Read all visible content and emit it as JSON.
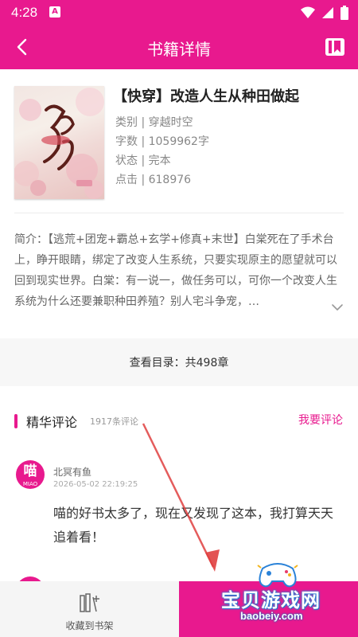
{
  "status_bar": {
    "time": "4:28",
    "app_icon_letter": "A",
    "icons": [
      "wifi-icon",
      "signal-icon",
      "battery-icon"
    ]
  },
  "header": {
    "title": "书籍详情",
    "back_icon": "chevron-left-icon",
    "action_icon": "bookshelf-icon"
  },
  "book": {
    "title": "【快穿】改造人生从种田做起",
    "category": "类别 | 穿越时空",
    "word_count": "字数 | 1059962字",
    "status": "状态 | 完本",
    "clicks": "点击 | 618976"
  },
  "synopsis": {
    "text": "简介：【逃荒+团宠+霸总+玄学+修真+末世】白棠死在了手术台上，睁开眼睛，绑定了改变人生系统，只要实现原主的愿望就可以回到现实世界。白棠：有一说一，做任务可以，可你一个改变人生系统为什么还要兼职种田养殖？别人宅斗争宠，…"
  },
  "catalog": {
    "label": "查看目录：共498章"
  },
  "reviews": {
    "title": "精华评论",
    "count": "1917条评论",
    "write_label": "我要评论",
    "items": [
      {
        "avatar_char": "喵",
        "avatar_sub": "MIAO",
        "user": "北冥有鱼",
        "time": "2026-05-02 22:19:25",
        "text": "喵的好书太多了，现在又发现了这本，我打算天天追着看！"
      }
    ]
  },
  "bottom_bar": {
    "favorite_label": "收藏到书架",
    "read_label": "",
    "favorite_icon": "add-to-shelf-icon"
  },
  "watermark": {
    "text": "宝贝游戏网",
    "url": "baobeiy.com"
  },
  "colors": {
    "accent": "#e8198e",
    "annotation_arrow": "#e04040"
  }
}
